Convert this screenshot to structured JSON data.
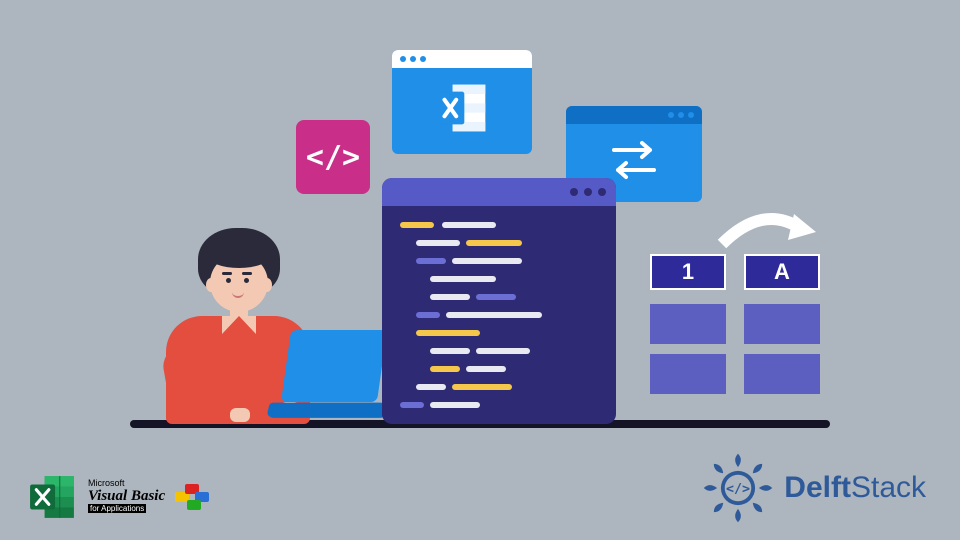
{
  "cards": {
    "brackets_label": "</>",
    "table_headers": {
      "col1": "1",
      "col2": "A"
    }
  },
  "bottom_left": {
    "ms": "Microsoft",
    "vb": "Visual Basic",
    "fa": "for Applications"
  },
  "bottom_right": {
    "brand_part1": "Delft",
    "brand_part2": "Stack"
  }
}
